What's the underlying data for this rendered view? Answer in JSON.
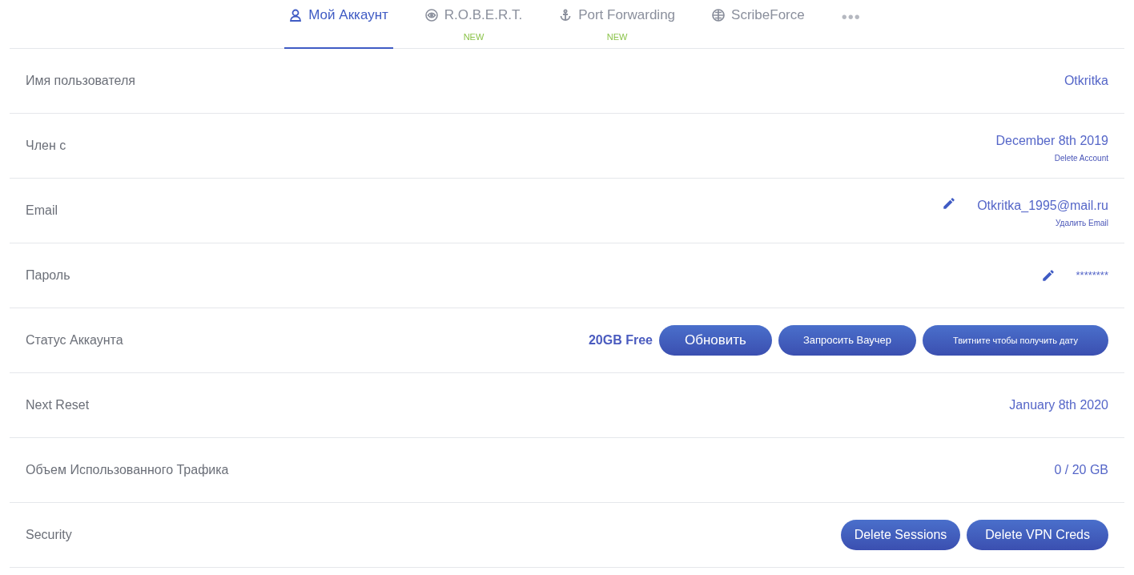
{
  "tabs": [
    {
      "kind": "tab",
      "label": "Мой Аккаунт",
      "selected": true
    },
    {
      "kind": "tab",
      "label": "R.O.B.E.R.T.",
      "badge": "NEW",
      "selected": false
    },
    {
      "kind": "tab",
      "label": "Port Forwarding",
      "badge": "NEW",
      "selected": false
    },
    {
      "kind": "tab",
      "label": "ScribeForce",
      "selected": false
    },
    {
      "kind": "more",
      "label": "•••",
      "selected": false
    }
  ],
  "rows": [
    {
      "kind": "text",
      "label": "Имя пользователя",
      "value": "Otkritka"
    },
    {
      "kind": "text",
      "label": "Член с",
      "value": "December 8th 2019",
      "link": "Delete Account"
    },
    {
      "kind": "editable",
      "label": "Email",
      "value": "Otkritka_1995@mail.ru",
      "link": "Удалить Email"
    },
    {
      "kind": "editable",
      "label": "Пароль",
      "value": "********"
    },
    {
      "kind": "status",
      "label": "Статус Аккаунта",
      "value": "20GB Free",
      "buttons": [
        "Обновить",
        "Запросить Ваучер",
        "Твитните чтобы получить дату"
      ]
    },
    {
      "kind": "text",
      "label": "Next Reset",
      "value": "January 8th 2020"
    },
    {
      "kind": "text",
      "label": "Объем Использованного Трафика",
      "value": "0 / 20 GB"
    },
    {
      "kind": "buttons",
      "label": "Security",
      "buttons": [
        "Delete Sessions",
        "Delete VPN Creds"
      ]
    }
  ]
}
